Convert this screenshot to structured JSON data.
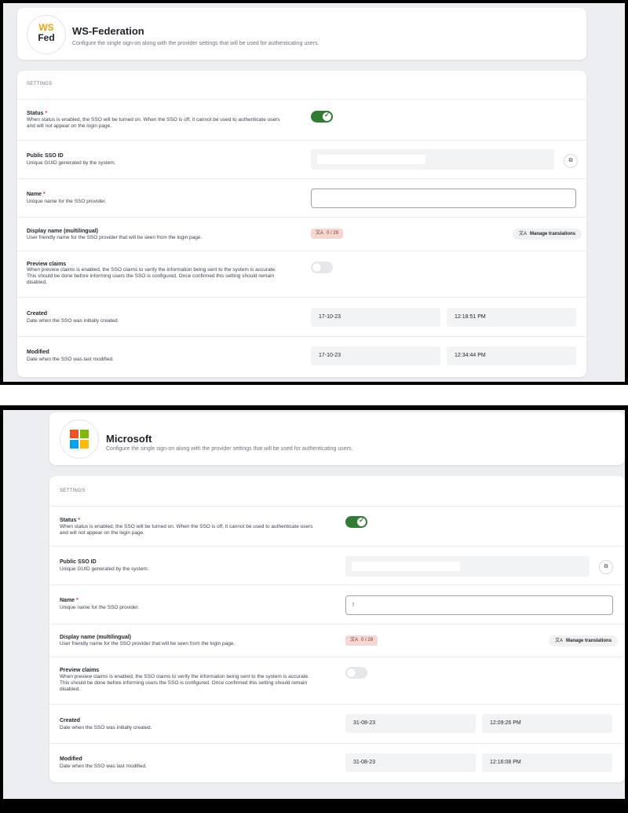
{
  "common": {
    "settings_label": "SETTINGS",
    "status_label": "Status",
    "required_mark": "*",
    "status_desc": "When status is enabled, the SSO will be turned on. When the SSO is off, it cannot be used to authenticate users and will not appear on the login page.",
    "public_id_label": "Public SSO ID",
    "public_id_desc": "Unique GUID generated by the system.",
    "name_label": "Name",
    "name_desc": "Unique name for the SSO provider.",
    "display_label": "Display name (multilingual)",
    "display_desc": "User friendly name for the SSO provider that will be seen from the login page.",
    "badge_icon": "文A",
    "badge_count": "0 / 29",
    "manage_icon": "文A",
    "manage_label": "Manage translations",
    "copy_icon": "⧉",
    "preview_label": "Preview claims",
    "preview_desc": "When preview claims is enabled, the SSO claims to verify the information being sent to the system is accurate. This should be done before informing users the SSO is configured. Once confirmed this setting should remain disabled.",
    "created_label": "Created",
    "created_desc": "Date when the SSO was initially created.",
    "modified_label": "Modified",
    "modified_desc": "Date when the SSO was last modified.",
    "header_sub": "Configure the single sign-on along with the provider settings that will be used for authenticating users."
  },
  "wsfed": {
    "title": "WS-Federation",
    "logo_top": "WS",
    "logo_bottom": "Fed",
    "logo_top_color": "#f0a30a",
    "status_on": true,
    "preview_on": false,
    "name_value": "",
    "created_date": "17-10-23",
    "created_time": "12:18:51 PM",
    "modified_date": "17-10-23",
    "modified_time": "12:34:44 PM"
  },
  "microsoft": {
    "title": "Microsoft",
    "logo_colors": [
      "#f25022",
      "#7fba00",
      "#00a4ef",
      "#ffb900"
    ],
    "status_on": true,
    "preview_on": false,
    "name_value": "!",
    "created_date": "31-08-23",
    "created_time": "12:09:26 PM",
    "modified_date": "31-08-23",
    "modified_time": "12:16:08 PM"
  }
}
